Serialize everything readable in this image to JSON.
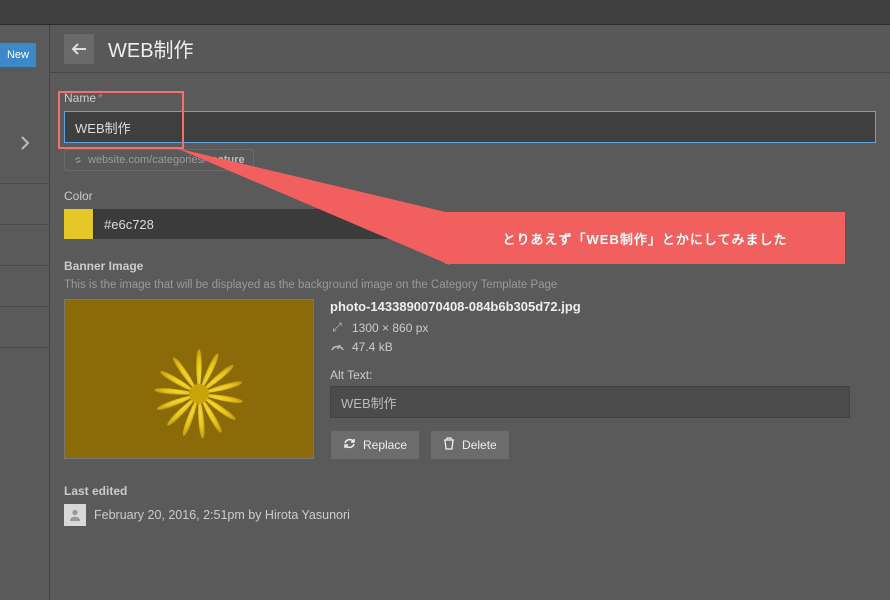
{
  "leftRail": {
    "new_label": "New"
  },
  "header": {
    "title": "WEB制作"
  },
  "fields": {
    "name_label": "Name",
    "name_value": "WEB制作",
    "url_prefix": "website.com/categories/",
    "url_slug": "nature",
    "color_label": "Color",
    "color_value": "#e6c728"
  },
  "banner": {
    "label": "Banner Image",
    "desc": "This is the image that will be displayed as the background image on the Category Template Page",
    "filename": "photo-1433890070408-084b6b305d72.jpg",
    "dimensions": "1300 × 860 px",
    "filesize": "47.4 kB",
    "alt_label": "Alt Text:",
    "alt_value": "WEB制作",
    "replace_label": "Replace",
    "delete_label": "Delete"
  },
  "lastEdited": {
    "label": "Last edited",
    "text": "February 20, 2016, 2:51pm by Hirota Yasunori"
  },
  "callout": {
    "text": "とりあえず「WEB制作」とかにしてみました"
  }
}
